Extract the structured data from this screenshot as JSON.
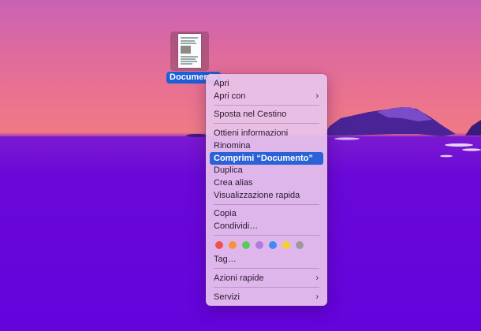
{
  "desktop_file": {
    "label": "Documento",
    "icon": "document-thumbnail-icon"
  },
  "menu": {
    "items": [
      {
        "label": "Apri"
      },
      {
        "label": "Apri con",
        "submenu": true
      },
      {
        "label": "Sposta nel Cestino"
      },
      {
        "label": "Ottieni informazioni"
      },
      {
        "label": "Rinomina"
      },
      {
        "label": "Comprimi “Documento”",
        "selected": true
      },
      {
        "label": "Duplica"
      },
      {
        "label": "Crea alias"
      },
      {
        "label": "Visualizzazione rapida"
      },
      {
        "label": "Copia"
      },
      {
        "label": "Condividi…"
      },
      {
        "label": "Tag…"
      },
      {
        "label": "Azioni rapide",
        "submenu": true
      },
      {
        "label": "Servizi",
        "submenu": true
      }
    ],
    "submenu_glyph": "›",
    "tag_colors": [
      "#f2504b",
      "#f7943b",
      "#5fc85a",
      "#b07be0",
      "#3f8bf0",
      "#f4d02f",
      "#9a9a9a"
    ]
  },
  "theme": {
    "selection_color": "#2b63d6",
    "label_highlight": "#1d5fd6"
  }
}
